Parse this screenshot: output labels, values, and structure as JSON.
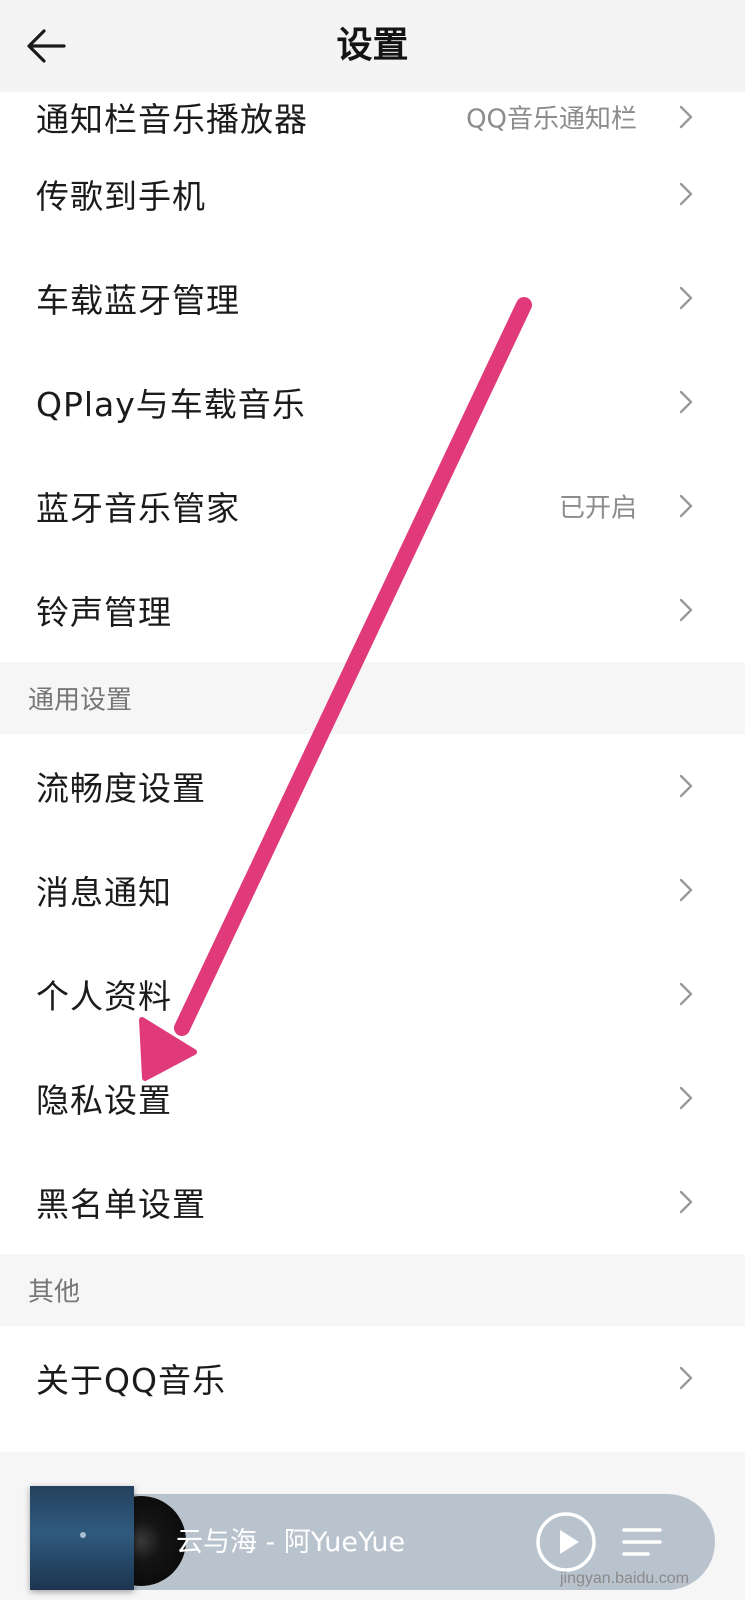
{
  "header": {
    "title": "设置",
    "back_icon": "arrow-left-icon"
  },
  "rows_top": [
    {
      "label": "通知栏音乐播放器",
      "value": "QQ音乐通知栏"
    },
    {
      "label": "传歌到手机",
      "value": ""
    },
    {
      "label": "车载蓝牙管理",
      "value": ""
    },
    {
      "label": "QPlay与车载音乐",
      "value": ""
    },
    {
      "label": "蓝牙音乐管家",
      "value": "已开启"
    },
    {
      "label": "铃声管理",
      "value": ""
    }
  ],
  "sections": [
    {
      "title": "通用设置",
      "items": [
        {
          "label": "流畅度设置"
        },
        {
          "label": "消息通知"
        },
        {
          "label": "个人资料"
        },
        {
          "label": "隐私设置"
        },
        {
          "label": "黑名单设置"
        }
      ]
    },
    {
      "title": "其他",
      "items": [
        {
          "label": "关于QQ音乐"
        }
      ]
    }
  ],
  "player": {
    "song_title": "云与海 - 阿YueYue",
    "play_icon": "play-icon",
    "list_icon": "playlist-icon"
  },
  "watermark": "jingyan.baidu.com",
  "annotation": {
    "color": "#e03a7a",
    "icon": "annotation-arrow"
  }
}
